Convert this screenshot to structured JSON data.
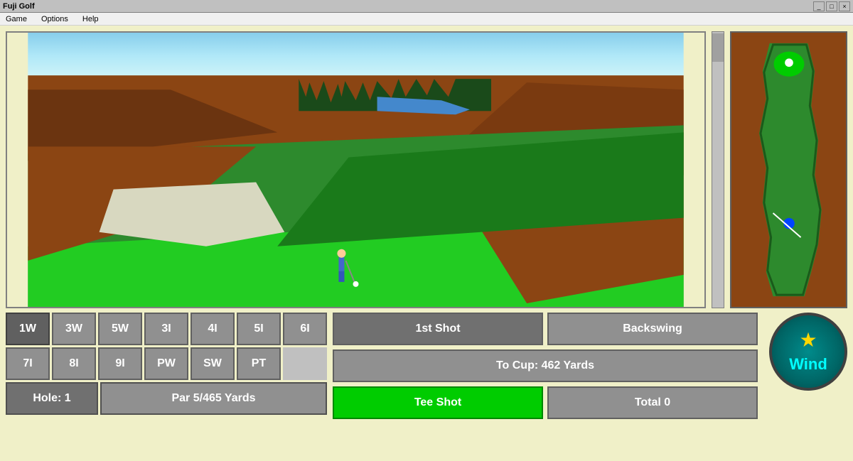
{
  "window": {
    "title": "Fuji Golf",
    "controls": [
      "_",
      "□",
      "×"
    ]
  },
  "menu": {
    "items": [
      "Game",
      "Options",
      "Help"
    ]
  },
  "clubs": {
    "row1": [
      "1W",
      "3W",
      "5W",
      "3I",
      "4I",
      "5I",
      "6I"
    ],
    "row2": [
      "7I",
      "8I",
      "9I",
      "PW",
      "SW",
      "PT",
      ""
    ],
    "selected": "1W"
  },
  "hole_info": {
    "hole_label": "Hole: 1",
    "par_label": "Par 5/465 Yards"
  },
  "shot_controls": {
    "shot_button": "1st Shot",
    "backswing_button": "Backswing",
    "distance_label": "To Cup: 462 Yards",
    "tee_shot_label": "Tee Shot",
    "total_label": "Total 0"
  },
  "wind": {
    "label": "Wind",
    "star": "★"
  },
  "colors": {
    "sky": "#87CEEB",
    "fairway": "#2d8a2d",
    "rough": "#1a6b1a",
    "sand": "#e8e8d8",
    "dirt": "#8B4513",
    "bright_fairway": "#00cc00",
    "tee_shot_bg": "#00cc00"
  }
}
